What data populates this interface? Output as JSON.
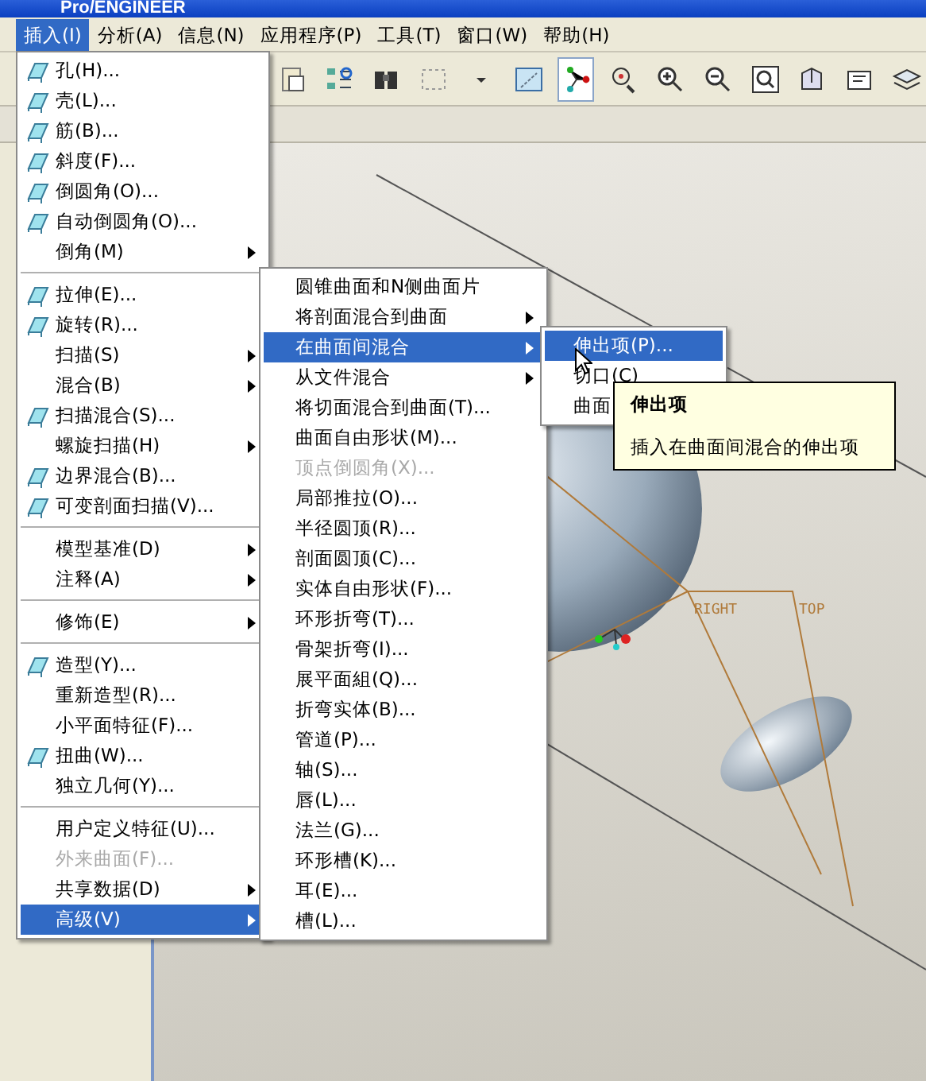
{
  "window": {
    "title": "Pro/ENGINEER"
  },
  "menubar": [
    {
      "label": "插入(I)",
      "selected": true
    },
    {
      "label": "分析(A)",
      "selected": false
    },
    {
      "label": "信息(N)",
      "selected": false
    },
    {
      "label": "应用程序(P)",
      "selected": false
    },
    {
      "label": "工具(T)",
      "selected": false
    },
    {
      "label": "窗口(W)",
      "selected": false
    },
    {
      "label": "帮助(H)",
      "selected": false
    }
  ],
  "insert_menu": {
    "groups": [
      [
        {
          "label": "孔(H)...",
          "icon": true,
          "submenu": false,
          "disabled": false,
          "selected": false
        },
        {
          "label": "壳(L)...",
          "icon": true,
          "submenu": false,
          "disabled": false,
          "selected": false
        },
        {
          "label": "筋(B)...",
          "icon": true,
          "submenu": false,
          "disabled": false,
          "selected": false
        },
        {
          "label": "斜度(F)...",
          "icon": true,
          "submenu": false,
          "disabled": false,
          "selected": false
        },
        {
          "label": "倒圆角(O)...",
          "icon": true,
          "submenu": false,
          "disabled": false,
          "selected": false
        },
        {
          "label": "自动倒圆角(O)...",
          "icon": true,
          "submenu": false,
          "disabled": false,
          "selected": false
        },
        {
          "label": "倒角(M)",
          "icon": false,
          "submenu": true,
          "disabled": false,
          "selected": false
        }
      ],
      [
        {
          "label": "拉伸(E)...",
          "icon": true,
          "submenu": false,
          "disabled": false,
          "selected": false
        },
        {
          "label": "旋转(R)...",
          "icon": true,
          "submenu": false,
          "disabled": false,
          "selected": false
        },
        {
          "label": "扫描(S)",
          "icon": false,
          "submenu": true,
          "disabled": false,
          "selected": false
        },
        {
          "label": "混合(B)",
          "icon": false,
          "submenu": true,
          "disabled": false,
          "selected": false
        },
        {
          "label": "扫描混合(S)...",
          "icon": true,
          "submenu": false,
          "disabled": false,
          "selected": false
        },
        {
          "label": "螺旋扫描(H)",
          "icon": false,
          "submenu": true,
          "disabled": false,
          "selected": false
        },
        {
          "label": "边界混合(B)...",
          "icon": true,
          "submenu": false,
          "disabled": false,
          "selected": false
        },
        {
          "label": "可变剖面扫描(V)...",
          "icon": true,
          "submenu": false,
          "disabled": false,
          "selected": false
        }
      ],
      [
        {
          "label": "模型基准(D)",
          "icon": false,
          "submenu": true,
          "disabled": false,
          "selected": false
        },
        {
          "label": "注释(A)",
          "icon": false,
          "submenu": true,
          "disabled": false,
          "selected": false
        }
      ],
      [
        {
          "label": "修饰(E)",
          "icon": false,
          "submenu": true,
          "disabled": false,
          "selected": false
        }
      ],
      [
        {
          "label": "造型(Y)...",
          "icon": true,
          "submenu": false,
          "disabled": false,
          "selected": false
        },
        {
          "label": "重新造型(R)...",
          "icon": false,
          "submenu": false,
          "disabled": false,
          "selected": false
        },
        {
          "label": "小平面特征(F)...",
          "icon": false,
          "submenu": false,
          "disabled": false,
          "selected": false
        },
        {
          "label": "扭曲(W)...",
          "icon": true,
          "submenu": false,
          "disabled": false,
          "selected": false
        },
        {
          "label": "独立几何(Y)...",
          "icon": false,
          "submenu": false,
          "disabled": false,
          "selected": false
        }
      ],
      [
        {
          "label": "用户定义特征(U)...",
          "icon": false,
          "submenu": false,
          "disabled": false,
          "selected": false
        },
        {
          "label": "外来曲面(F)...",
          "icon": false,
          "submenu": false,
          "disabled": true,
          "selected": false
        },
        {
          "label": "共享数据(D)",
          "icon": false,
          "submenu": true,
          "disabled": false,
          "selected": false
        },
        {
          "label": "高级(V)",
          "icon": false,
          "submenu": true,
          "disabled": false,
          "selected": true
        }
      ]
    ]
  },
  "advanced_menu": {
    "items": [
      {
        "label": "圆锥曲面和N侧曲面片",
        "submenu": false,
        "disabled": false,
        "selected": false
      },
      {
        "label": "将剖面混合到曲面",
        "submenu": true,
        "disabled": false,
        "selected": false
      },
      {
        "label": "在曲面间混合",
        "submenu": true,
        "disabled": false,
        "selected": true
      },
      {
        "label": "从文件混合",
        "submenu": true,
        "disabled": false,
        "selected": false
      },
      {
        "label": "将切面混合到曲面(T)...",
        "submenu": false,
        "disabled": false,
        "selected": false
      },
      {
        "label": "曲面自由形状(M)...",
        "submenu": false,
        "disabled": false,
        "selected": false
      },
      {
        "label": "顶点倒圆角(X)...",
        "submenu": false,
        "disabled": true,
        "selected": false
      },
      {
        "label": "局部推拉(O)...",
        "submenu": false,
        "disabled": false,
        "selected": false
      },
      {
        "label": "半径圆顶(R)...",
        "submenu": false,
        "disabled": false,
        "selected": false
      },
      {
        "label": "剖面圆顶(C)...",
        "submenu": false,
        "disabled": false,
        "selected": false
      },
      {
        "label": "实体自由形状(F)...",
        "submenu": false,
        "disabled": false,
        "selected": false
      },
      {
        "label": "环形折弯(T)...",
        "submenu": false,
        "disabled": false,
        "selected": false
      },
      {
        "label": "骨架折弯(I)...",
        "submenu": false,
        "disabled": false,
        "selected": false
      },
      {
        "label": "展平面組(Q)...",
        "submenu": false,
        "disabled": false,
        "selected": false
      },
      {
        "label": "折弯实体(B)...",
        "submenu": false,
        "disabled": false,
        "selected": false
      },
      {
        "label": "管道(P)...",
        "submenu": false,
        "disabled": false,
        "selected": false
      },
      {
        "label": "轴(S)...",
        "submenu": false,
        "disabled": false,
        "selected": false
      },
      {
        "label": "唇(L)...",
        "submenu": false,
        "disabled": false,
        "selected": false
      },
      {
        "label": "法兰(G)...",
        "submenu": false,
        "disabled": false,
        "selected": false
      },
      {
        "label": "环形槽(K)...",
        "submenu": false,
        "disabled": false,
        "selected": false
      },
      {
        "label": "耳(E)...",
        "submenu": false,
        "disabled": false,
        "selected": false
      },
      {
        "label": "槽(L)...",
        "submenu": false,
        "disabled": false,
        "selected": false
      }
    ]
  },
  "blend_menu": {
    "items": [
      {
        "label": "伸出项(P)...",
        "selected": true
      },
      {
        "label": "切口(C)",
        "selected": false
      },
      {
        "label": "曲面",
        "selected": false
      }
    ]
  },
  "tooltip": {
    "title": "伸出项",
    "text": "插入在曲面间混合的伸出项"
  },
  "viewport": {
    "datum_labels": [
      "RIGHT",
      "TOP"
    ]
  }
}
